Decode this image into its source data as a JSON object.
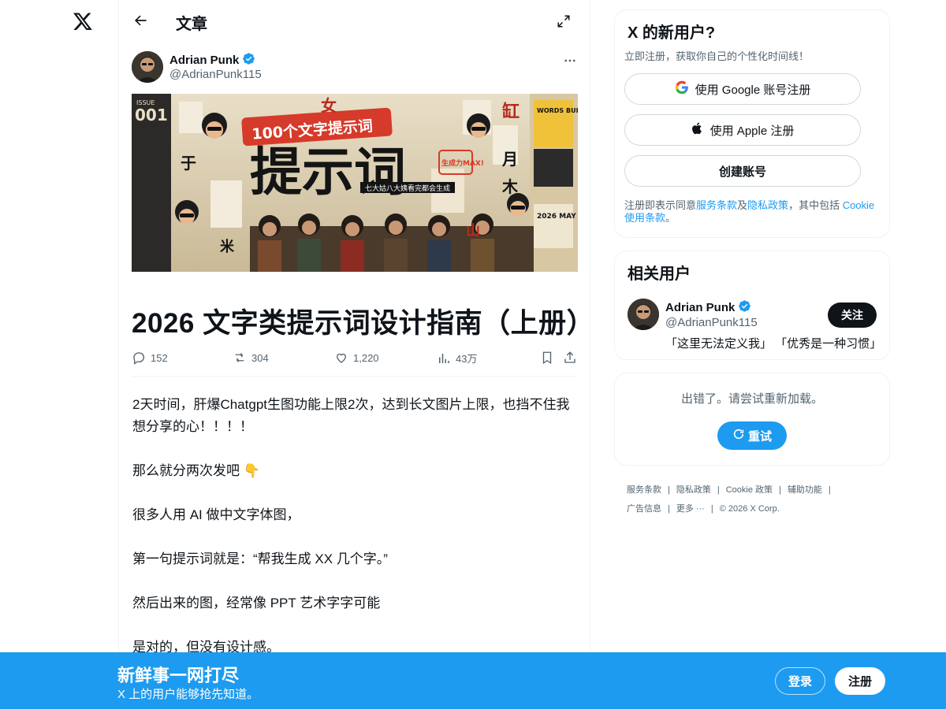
{
  "colors": {
    "accent": "#1d9bf0",
    "text": "#0f1419",
    "muted": "#536471",
    "border": "#eff3f4",
    "verified": "#1d9bf0"
  },
  "topbar": {
    "title": "文章",
    "back_icon": "arrow-left-icon",
    "expand_icon": "expand-icon"
  },
  "author": {
    "name": "Adrian Punk",
    "handle": "@AdrianPunk115",
    "verified": true
  },
  "article": {
    "title": "2026 文字类提示词设计指南（上册）",
    "hero_image": "collage cover image with large characters 提示词",
    "hero_text": {
      "big_title": "提示词",
      "banner": "100个文字提示词",
      "issue_label": "ISSUE",
      "issue_number": "001",
      "stamp": "生成力MAX!",
      "caption": "七大姑八大姨看完都会生成",
      "side_card": "WORDS BUILD WORLDS.",
      "date_card": "2026 MAY"
    },
    "stats": {
      "replies": "152",
      "reposts": "304",
      "likes": "1,220",
      "views": "43万"
    },
    "paragraphs": [
      "2天时间，肝爆Chatgpt生图功能上限2次，达到长文图片上限，也挡不住我想分享的心！！！！",
      "那么就分两次发吧 👇",
      "很多人用 AI 做中文字体图，",
      "第一句提示词就是：“帮我生成 XX 几个字。”",
      "然后出来的图，经常像 PPT 艺术字字可能",
      "是对的，但没有设计感。"
    ]
  },
  "signup": {
    "title": "X 的新用户?",
    "subtitle": "立即注册，获取你自己的个性化时间线！",
    "google_label": "使用 Google 账号注册",
    "apple_label": "使用 Apple 注册",
    "create_label": "创建账号",
    "terms_prefix": "注册即表示同意",
    "terms_link": "服务条款",
    "terms_and": "及",
    "privacy_link": "隐私政策",
    "terms_mid": "，其中包括 ",
    "cookie_link": "Cookie 使用条款",
    "terms_end": "。"
  },
  "related": {
    "title": "相关用户",
    "name": "Adrian Punk",
    "handle": "@AdrianPunk115",
    "follow_label": "关注",
    "bio": "「这里无法定义我」 「优秀是一种习惯」"
  },
  "error": {
    "message": "出错了。请尝试重新加载。",
    "retry_label": "重试"
  },
  "footer": {
    "links": [
      "服务条款",
      "隐私政策",
      "Cookie 政策",
      "辅助功能",
      "广告信息",
      "更多 ···"
    ],
    "copyright": "© 2026 X Corp."
  },
  "banner": {
    "title": "新鲜事一网打尽",
    "subtitle": "X 上的用户能够抢先知道。",
    "login_label": "登录",
    "signup_label": "注册"
  }
}
